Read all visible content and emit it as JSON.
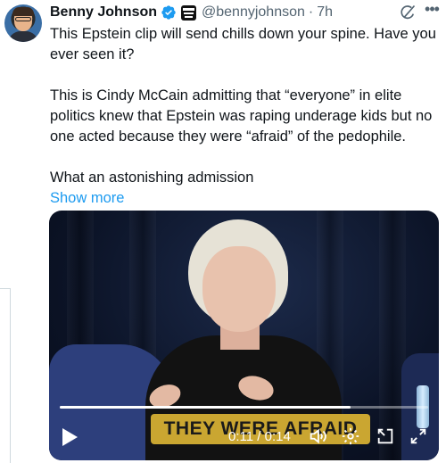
{
  "author": {
    "name": "Benny Johnson",
    "handle": "@bennyjohnson",
    "separator": "·",
    "time": "7h"
  },
  "tweet": {
    "paragraph1": "This Epstein clip will send chills down your spine. Have you ever seen it?",
    "paragraph2": "This is Cindy McCain admitting that “everyone” in elite politics knew that Epstein was raping underage kids but no one acted because they were “afraid” of the pedophile.",
    "paragraph3": "What an astonishing admission",
    "show_more": "Show more"
  },
  "icons": {
    "verified": "verified-badge-icon",
    "affiliate": "affiliate-badge-icon",
    "grok": "grok-icon",
    "more": "more-icon",
    "play": "play-icon",
    "volume": "volume-icon",
    "settings": "gear-icon",
    "pip": "picture-in-picture-icon",
    "fullscreen": "fullscreen-icon"
  },
  "video": {
    "caption": "THEY WERE AFRAID",
    "current_time": "0:11",
    "time_separator": "/",
    "duration": "0:14",
    "progress": 0.79
  },
  "colors": {
    "accent": "#1d9bf0",
    "verified": "#1d9bf0",
    "secondary_text": "#536471",
    "caption_bg": "#caa631"
  }
}
